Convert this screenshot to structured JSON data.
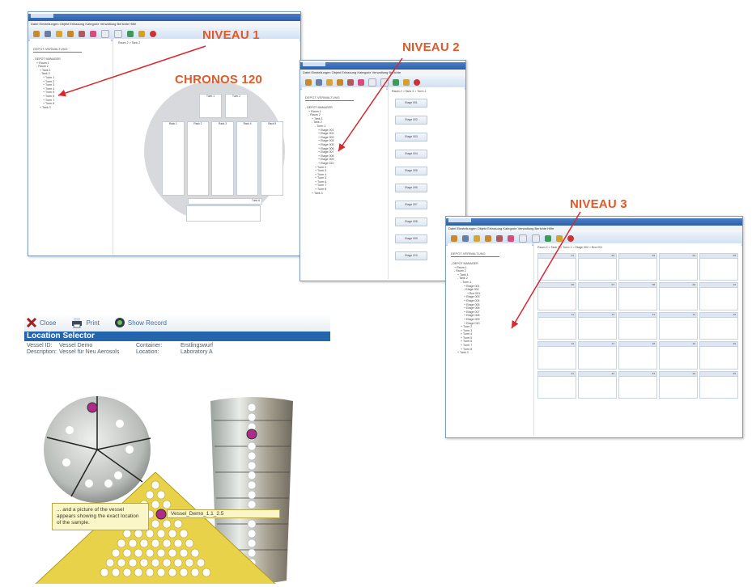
{
  "labels": {
    "niveau1": "NIVEAU 1",
    "niveau2": "NIVEAU 2",
    "niveau3": "NIVEAU 3",
    "chronos": "CHRONOS 120"
  },
  "window1": {
    "menu": "Datei  Einstellungen  Objekt  Erfassung  Kategorie  Verwaltung  Berichte  Hilfe",
    "tree_header": "DEPOT-VERWALTUNG",
    "tree": [
      "- DEPOT MANAGER",
      "+ Raum 1",
      "- Raum 2",
      "+ Tank 1",
      "- Tank 2",
      "+ Turm 1",
      "+ Turm 2",
      "+ Turm 3",
      "+ Turm 4",
      "+ Turm 5",
      "+ Turm 6",
      "+ Turm 7",
      "+ Turm 8",
      "+ Tank 3"
    ],
    "crumb": "Raum 2 > Tank 2",
    "racks_top": [
      "Turm 1",
      "Turm 2"
    ],
    "racks": [
      "Rack 1",
      "Rack 2",
      "Rack 3",
      "Rack 4",
      "Rack 5"
    ],
    "bottom_label": "Turm 6"
  },
  "window2": {
    "menu": "Datei  Einstellungen  Objekt  Erfassung  Kategorie  Verwaltung  Berichte",
    "tree_header": "DEPOT-VERWALTUNG",
    "tree": [
      "- DEPOT MANAGER",
      "+ Raum 1",
      "- Raum 2",
      "+ Tank 1",
      "- Tank 2",
      "- Turm 1",
      "+ Etage 001",
      "+ Etage 002",
      "+ Etage 003",
      "+ Etage 004",
      "+ Etage 005",
      "+ Etage 006",
      "+ Etage 007",
      "+ Etage 008",
      "+ Etage 009",
      "+ Etage 010",
      "+ Turm 2",
      "+ Turm 3",
      "+ Turm 4",
      "+ Turm 5",
      "+ Turm 6",
      "+ Turm 7",
      "+ Turm 8",
      "+ Tank 3"
    ],
    "crumb": "Raum 2 > Tank 2 > Turm 1",
    "stages": [
      "Etage 001",
      "Etage 002",
      "Etage 003",
      "Etage 004",
      "Etage 005",
      "Etage 006",
      "Etage 007",
      "Etage 008",
      "Etage 009",
      "Etage 010"
    ]
  },
  "window3": {
    "menu": "Datei  Einstellungen  Objekt  Erfassung  Kategorie  Verwaltung  Berichte  Hilfe",
    "tree_header": "DEPOT-VERWALTUNG",
    "tree": [
      "- DEPOT MANAGER",
      "+ Raum 1",
      "- Raum 2",
      "+ Tank 1",
      "- Tank 2",
      "- Turm 1",
      "+ Etage 001",
      "- Etage 002",
      "+ Box 001",
      "+ Etage 003",
      "+ Etage 004",
      "+ Etage 005",
      "+ Etage 006",
      "+ Etage 007",
      "+ Etage 008",
      "+ Etage 009",
      "+ Etage 010",
      "+ Turm 2",
      "+ Turm 3",
      "+ Turm 4",
      "+ Turm 5",
      "+ Turm 6",
      "+ Turm 7",
      "+ Turm 8",
      "+ Tank 3"
    ],
    "crumb": "Raum 2 > Tank 2 > Turm 1 > Etage 002 > Box 001",
    "cells": [
      [
        "01",
        "02",
        "03",
        "04",
        "05"
      ],
      [
        "06",
        "07",
        "08",
        "09",
        "10"
      ],
      [
        "11",
        "12",
        "13",
        "14",
        "15"
      ],
      [
        "16",
        "17",
        "18",
        "19",
        "20"
      ],
      [
        "21",
        "22",
        "23",
        "24",
        "25"
      ]
    ]
  },
  "location_selector": {
    "buttons": [
      "Close",
      "Print",
      "Show Record"
    ],
    "title": "Location Selector",
    "info": [
      [
        "Vessel ID:",
        "Vessel Demo",
        "Container:",
        "Erstlingswurf"
      ],
      [
        "Description:",
        "Vessel für Neu Aerosols",
        "Location:",
        "Laboratory A"
      ]
    ],
    "tooltip": "... and a picture of the vessel appears showing the exact location of the sample.",
    "tag": "Vessel_Demo_1.1_2.5"
  },
  "colors": {
    "accent": "#e05a2a",
    "title_blue": "#2565ac",
    "tooltip_bg": "#fbf6c8",
    "yellow_rack": "#e8d24a"
  }
}
